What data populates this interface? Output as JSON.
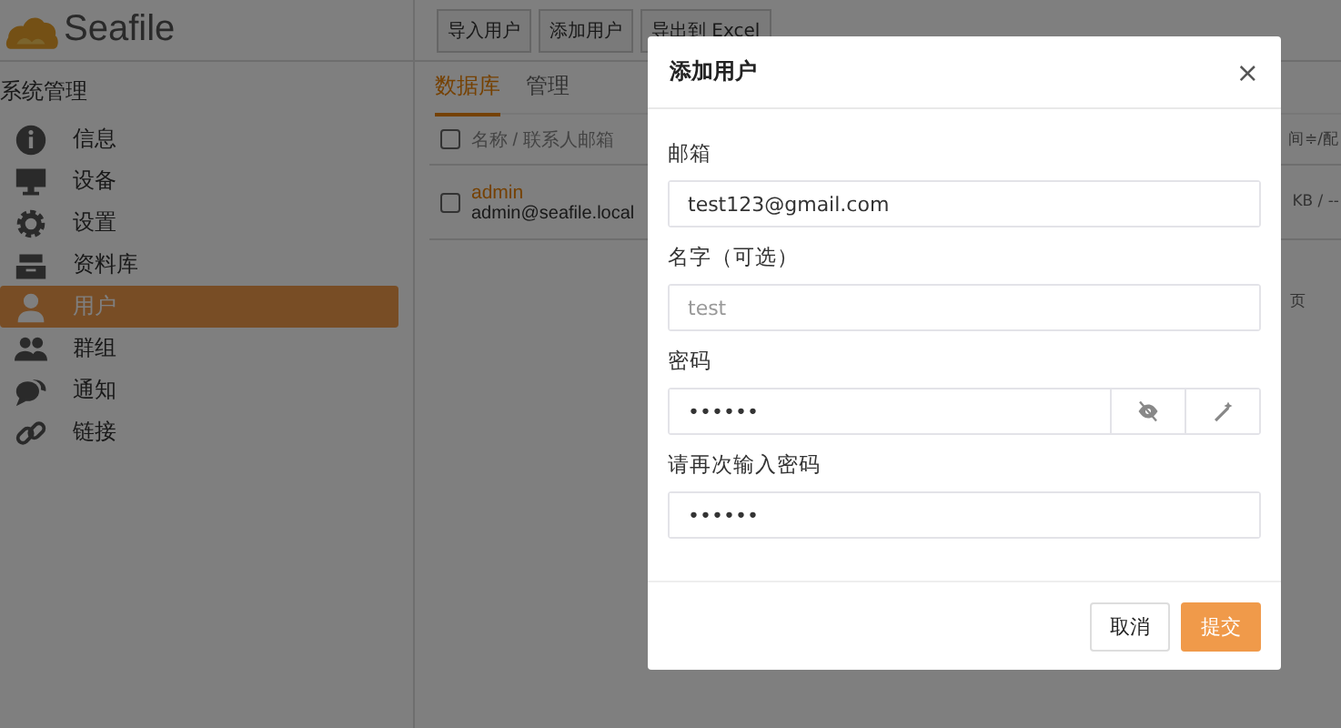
{
  "brand": {
    "name": "Seafile"
  },
  "toolbar": {
    "buttons": [
      "导入用户",
      "添加用户",
      "导出到 Excel"
    ]
  },
  "sidebar": {
    "heading": "系统管理",
    "items": [
      {
        "label": "信息",
        "selected": false
      },
      {
        "label": "设备",
        "selected": false
      },
      {
        "label": "设置",
        "selected": false
      },
      {
        "label": "资料库",
        "selected": false
      },
      {
        "label": "用户",
        "selected": true
      },
      {
        "label": "群组",
        "selected": false
      },
      {
        "label": "通知",
        "selected": false
      },
      {
        "label": "链接",
        "selected": false
      }
    ]
  },
  "tabs": [
    {
      "label": "数据库",
      "selected": true
    },
    {
      "label": "管理",
      "selected": false
    }
  ],
  "table": {
    "all_checked": false,
    "columns": [
      "名称 / 联系人邮箱",
      "间≑/配"
    ],
    "rows": [
      {
        "checked": false,
        "name": "admin",
        "email": "admin@seafile.local",
        "column_2": "KB / --"
      }
    ]
  },
  "pager": {
    "text": "页"
  },
  "dialog": {
    "title": "添加用户",
    "close": "×",
    "fields": [
      {
        "kind": "text",
        "label": "邮箱",
        "value": "test123@gmail.com"
      },
      {
        "kind": "text",
        "label": "名字（可选）",
        "placeholder": "test"
      },
      {
        "kind": "password",
        "label": "密码",
        "value": "••••••"
      },
      {
        "kind": "text",
        "label": "请再次输入密码",
        "value": "••••••"
      }
    ],
    "buttons": [
      {
        "label": "取消",
        "kind": "secondary"
      },
      {
        "label": "提交",
        "kind": "primary"
      }
    ]
  }
}
